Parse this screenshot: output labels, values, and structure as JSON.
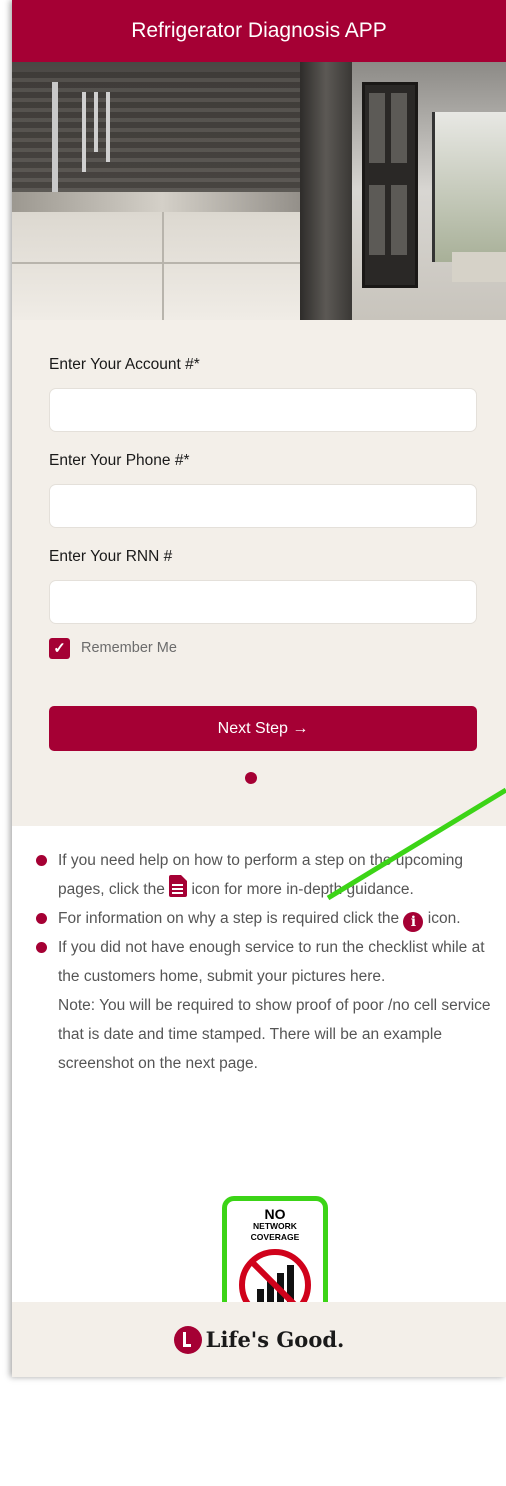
{
  "header": {
    "title": "Refrigerator Diagnosis APP"
  },
  "form": {
    "account_label": "Enter Your Account #*",
    "account_value": "",
    "phone_label": "Enter Your Phone #*",
    "phone_value": "",
    "rnn_label": "Enter Your RNN #",
    "rnn_value": "",
    "remember_label": "Remember Me",
    "remember_checked": true,
    "next_button": "Next Step →"
  },
  "info": {
    "item1_before": "If you need help on how to perform a step on the upcoming pages, click the ",
    "item1_after": " icon for more in-depth guidance.",
    "item2_before": "For information on why a step is required click the ",
    "item2_after": " icon.",
    "item3": "If you did not have enough service to run the checklist while at the customers home, submit your pictures here.",
    "note": "Note: You will be required to show proof of poor /no cell service that is date and time stamped. There will be an example screenshot on the next page."
  },
  "no_coverage": {
    "line1": "NO",
    "line2": "NETWORK",
    "line3": "COVERAGE",
    "icon": "no-signal-icon"
  },
  "footer": {
    "logo_text": "Life's Good."
  },
  "colors": {
    "brand": "#a50034",
    "highlight": "#3cd417",
    "panel": "#f3efe9"
  }
}
